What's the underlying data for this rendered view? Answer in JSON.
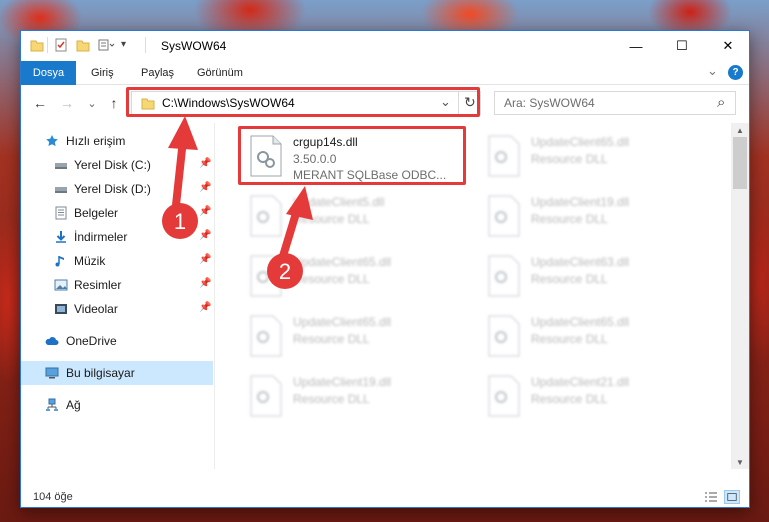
{
  "window": {
    "title": "SysWOW64",
    "controls": {
      "minimize": "—",
      "maximize": "☐",
      "close": "✕"
    }
  },
  "ribbon": {
    "tabs": [
      "Dosya",
      "Giriş",
      "Paylaş",
      "Görünüm"
    ],
    "collapse_glyph": "⌄",
    "help_glyph": "?"
  },
  "navigation": {
    "back": "←",
    "forward": "→",
    "recent": "⌄",
    "up": "↑",
    "address": "C:\\Windows\\SysWOW64",
    "address_dropdown": "⌄",
    "refresh": "↻",
    "search_placeholder": "Ara: SysWOW64",
    "search_icon": "⌕"
  },
  "sidebar": {
    "items": [
      {
        "label": "Hızlı erişim",
        "icon": "star-icon",
        "pinned": false
      },
      {
        "label": "Yerel Disk (C:)",
        "icon": "drive-icon",
        "pinned": true
      },
      {
        "label": "Yerel Disk (D:)",
        "icon": "drive-icon",
        "pinned": true
      },
      {
        "label": "Belgeler",
        "icon": "documents-icon",
        "pinned": true
      },
      {
        "label": "İndirmeler",
        "icon": "download-icon",
        "pinned": true
      },
      {
        "label": "Müzik",
        "icon": "music-icon",
        "pinned": true
      },
      {
        "label": "Resimler",
        "icon": "pictures-icon",
        "pinned": true
      },
      {
        "label": "Videolar",
        "icon": "videos-icon",
        "pinned": true
      },
      {
        "label": "OneDrive",
        "icon": "cloud-icon",
        "pinned": false
      },
      {
        "label": "Bu bilgisayar",
        "icon": "computer-icon",
        "pinned": false,
        "selected": true
      },
      {
        "label": "Ağ",
        "icon": "network-icon",
        "pinned": false
      }
    ],
    "pin_glyph": "📌"
  },
  "files": [
    {
      "name": "crgup14s.dll",
      "line2": "3.50.0.0",
      "line3": "MERANT SQLBase ODBC...",
      "highlighted": true
    },
    {
      "name": "UpdateClient65.dll",
      "line2": "Resource DLL",
      "blurred": true
    },
    {
      "name": "UpdateClient5.dll",
      "line2": "Resource DLL",
      "blurred": true
    },
    {
      "name": "UpdateClient19.dll",
      "line2": "Resource DLL",
      "blurred": true
    },
    {
      "name": "UpdateClient65.dll",
      "line2": "Resource DLL",
      "blurred": true
    },
    {
      "name": "UpdateClient63.dll",
      "line2": "Resource DLL",
      "blurred": true
    },
    {
      "name": "UpdateClient65.dll",
      "line2": "Resource DLL",
      "blurred": true
    },
    {
      "name": "UpdateClient65.dll",
      "line2": "Resource DLL",
      "blurred": true
    },
    {
      "name": "UpdateClient19.dll",
      "line2": "Resource DLL",
      "blurred": true
    },
    {
      "name": "UpdateClient21.dll",
      "line2": "Resource DLL",
      "blurred": true
    }
  ],
  "status": {
    "item_count": "104 öğe"
  },
  "annotations": {
    "color": "#e43a3a",
    "badge_1": "1",
    "badge_2": "2"
  },
  "colors": {
    "accent": "#1979ca",
    "selection": "#cce8ff"
  }
}
